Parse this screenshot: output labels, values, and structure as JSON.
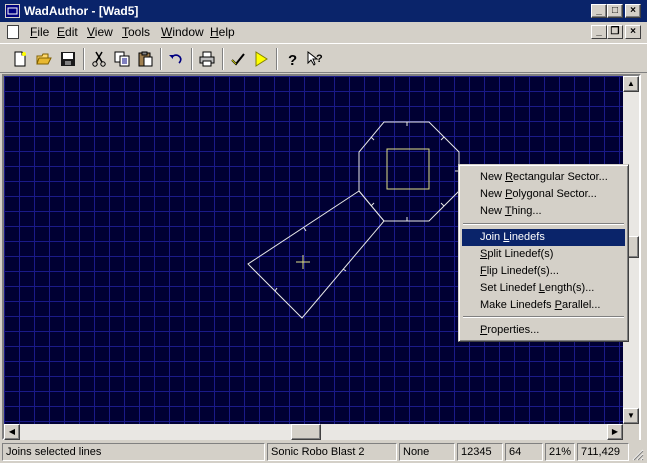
{
  "window": {
    "title": "WadAuthor - [Wad5]",
    "controls": {
      "minimize": "_",
      "maximize": "□",
      "close": "×"
    },
    "mdi_controls": {
      "minimize": "_",
      "restore": "❐",
      "close": "×"
    }
  },
  "menubar": {
    "items": [
      {
        "label": "File",
        "accel": "F",
        "rest": "ile"
      },
      {
        "label": "Edit",
        "accel": "E",
        "rest": "dit"
      },
      {
        "label": "View",
        "accel": "V",
        "rest": "iew"
      },
      {
        "label": "Tools",
        "accel": "T",
        "rest": "ools"
      },
      {
        "label": "Window",
        "accel": "W",
        "rest": "indow"
      },
      {
        "label": "Help",
        "accel": "H",
        "rest": "elp"
      }
    ]
  },
  "toolbar": {
    "buttons": [
      "new-icon",
      "open-icon",
      "save-icon",
      "cut-icon",
      "copy-icon",
      "paste-icon",
      "undo-icon",
      "print-icon",
      "check-icon",
      "run-icon",
      "help-icon",
      "context-help-icon"
    ]
  },
  "context_menu": {
    "items": [
      {
        "pre": "New ",
        "accel": "R",
        "post": "ectangular Sector..."
      },
      {
        "pre": "New ",
        "accel": "P",
        "post": "olygonal Sector..."
      },
      {
        "pre": "New ",
        "accel": "T",
        "post": "hing..."
      },
      {
        "pre": "Join ",
        "accel": "L",
        "post": "inedefs",
        "selected": true
      },
      {
        "pre": "",
        "accel": "S",
        "post": "plit Linedef(s)"
      },
      {
        "pre": "",
        "accel": "F",
        "post": "lip Linedef(s)..."
      },
      {
        "pre": "Set Linedef ",
        "accel": "L",
        "post": "ength(s)..."
      },
      {
        "pre": "Make Linedefs ",
        "accel": "P",
        "post": "arallel..."
      },
      {
        "pre": "",
        "accel": "P",
        "post": "roperties..."
      }
    ]
  },
  "statusbar": {
    "message": "Joins selected lines",
    "game": "Sonic Robo Blast 2",
    "mode": "None",
    "value1": "12345",
    "value2": "64",
    "zoom": "21%",
    "coords": "711,429"
  },
  "colors": {
    "title_active": "#0a246a",
    "canvas_bg": "#000033",
    "grid": "#1a1a88",
    "sector_lines": "#e8e8e8",
    "inner_sector": "#e0e08a",
    "menu_highlight": "#0a246a"
  }
}
